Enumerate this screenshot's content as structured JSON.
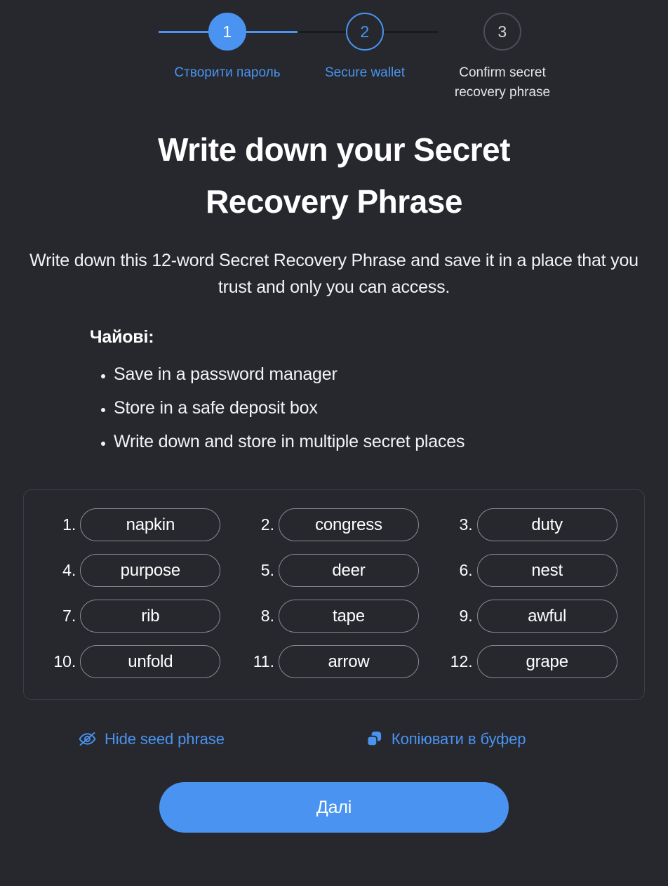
{
  "theme": {
    "background": "#26282e",
    "accent": "#4a93f0",
    "text_primary": "#ffffff",
    "pill_border": "#878a91",
    "box_border": "#3b3d44",
    "idle_step_border": "#4c4e55"
  },
  "stepper": {
    "steps": [
      {
        "number": "1",
        "label": "Створити пароль",
        "state": "done"
      },
      {
        "number": "2",
        "label": "Secure wallet",
        "state": "active"
      },
      {
        "number": "3",
        "label": "Confirm secret recovery phrase",
        "state": "idle"
      }
    ]
  },
  "header": {
    "title": "Write down your Secret Recovery Phrase",
    "subtitle": "Write down this 12-word Secret Recovery Phrase and save it in a place that you trust and only you can access."
  },
  "tips": {
    "heading": "Чайові:",
    "items": [
      "Save in a password manager",
      "Store in a safe deposit box",
      "Write down and store in multiple secret places"
    ]
  },
  "seed_phrase": {
    "word_count": 12,
    "words": [
      {
        "index": "1.",
        "word": "napkin"
      },
      {
        "index": "2.",
        "word": "congress"
      },
      {
        "index": "3.",
        "word": "duty"
      },
      {
        "index": "4.",
        "word": "purpose"
      },
      {
        "index": "5.",
        "word": "deer"
      },
      {
        "index": "6.",
        "word": "nest"
      },
      {
        "index": "7.",
        "word": "rib"
      },
      {
        "index": "8.",
        "word": "tape"
      },
      {
        "index": "9.",
        "word": "awful"
      },
      {
        "index": "10.",
        "word": "unfold"
      },
      {
        "index": "11.",
        "word": "arrow"
      },
      {
        "index": "12.",
        "word": "grape"
      }
    ]
  },
  "actions": {
    "hide": {
      "label": "Hide seed phrase",
      "icon": "eye-slash-icon"
    },
    "copy": {
      "label": "Копіювати в буфер",
      "icon": "copy-icon"
    }
  },
  "cta": {
    "label": "Далі"
  }
}
